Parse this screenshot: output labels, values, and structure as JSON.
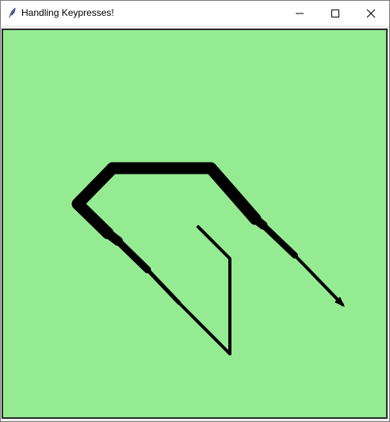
{
  "window": {
    "title": "Handling Keypresses!",
    "app_icon": "feather-icon",
    "controls": {
      "minimize_icon": "minimize-icon",
      "maximize_icon": "maximize-icon",
      "close_icon": "close-icon"
    }
  },
  "canvas": {
    "background_color": "#95eb91",
    "stroke_color": "#000000"
  }
}
